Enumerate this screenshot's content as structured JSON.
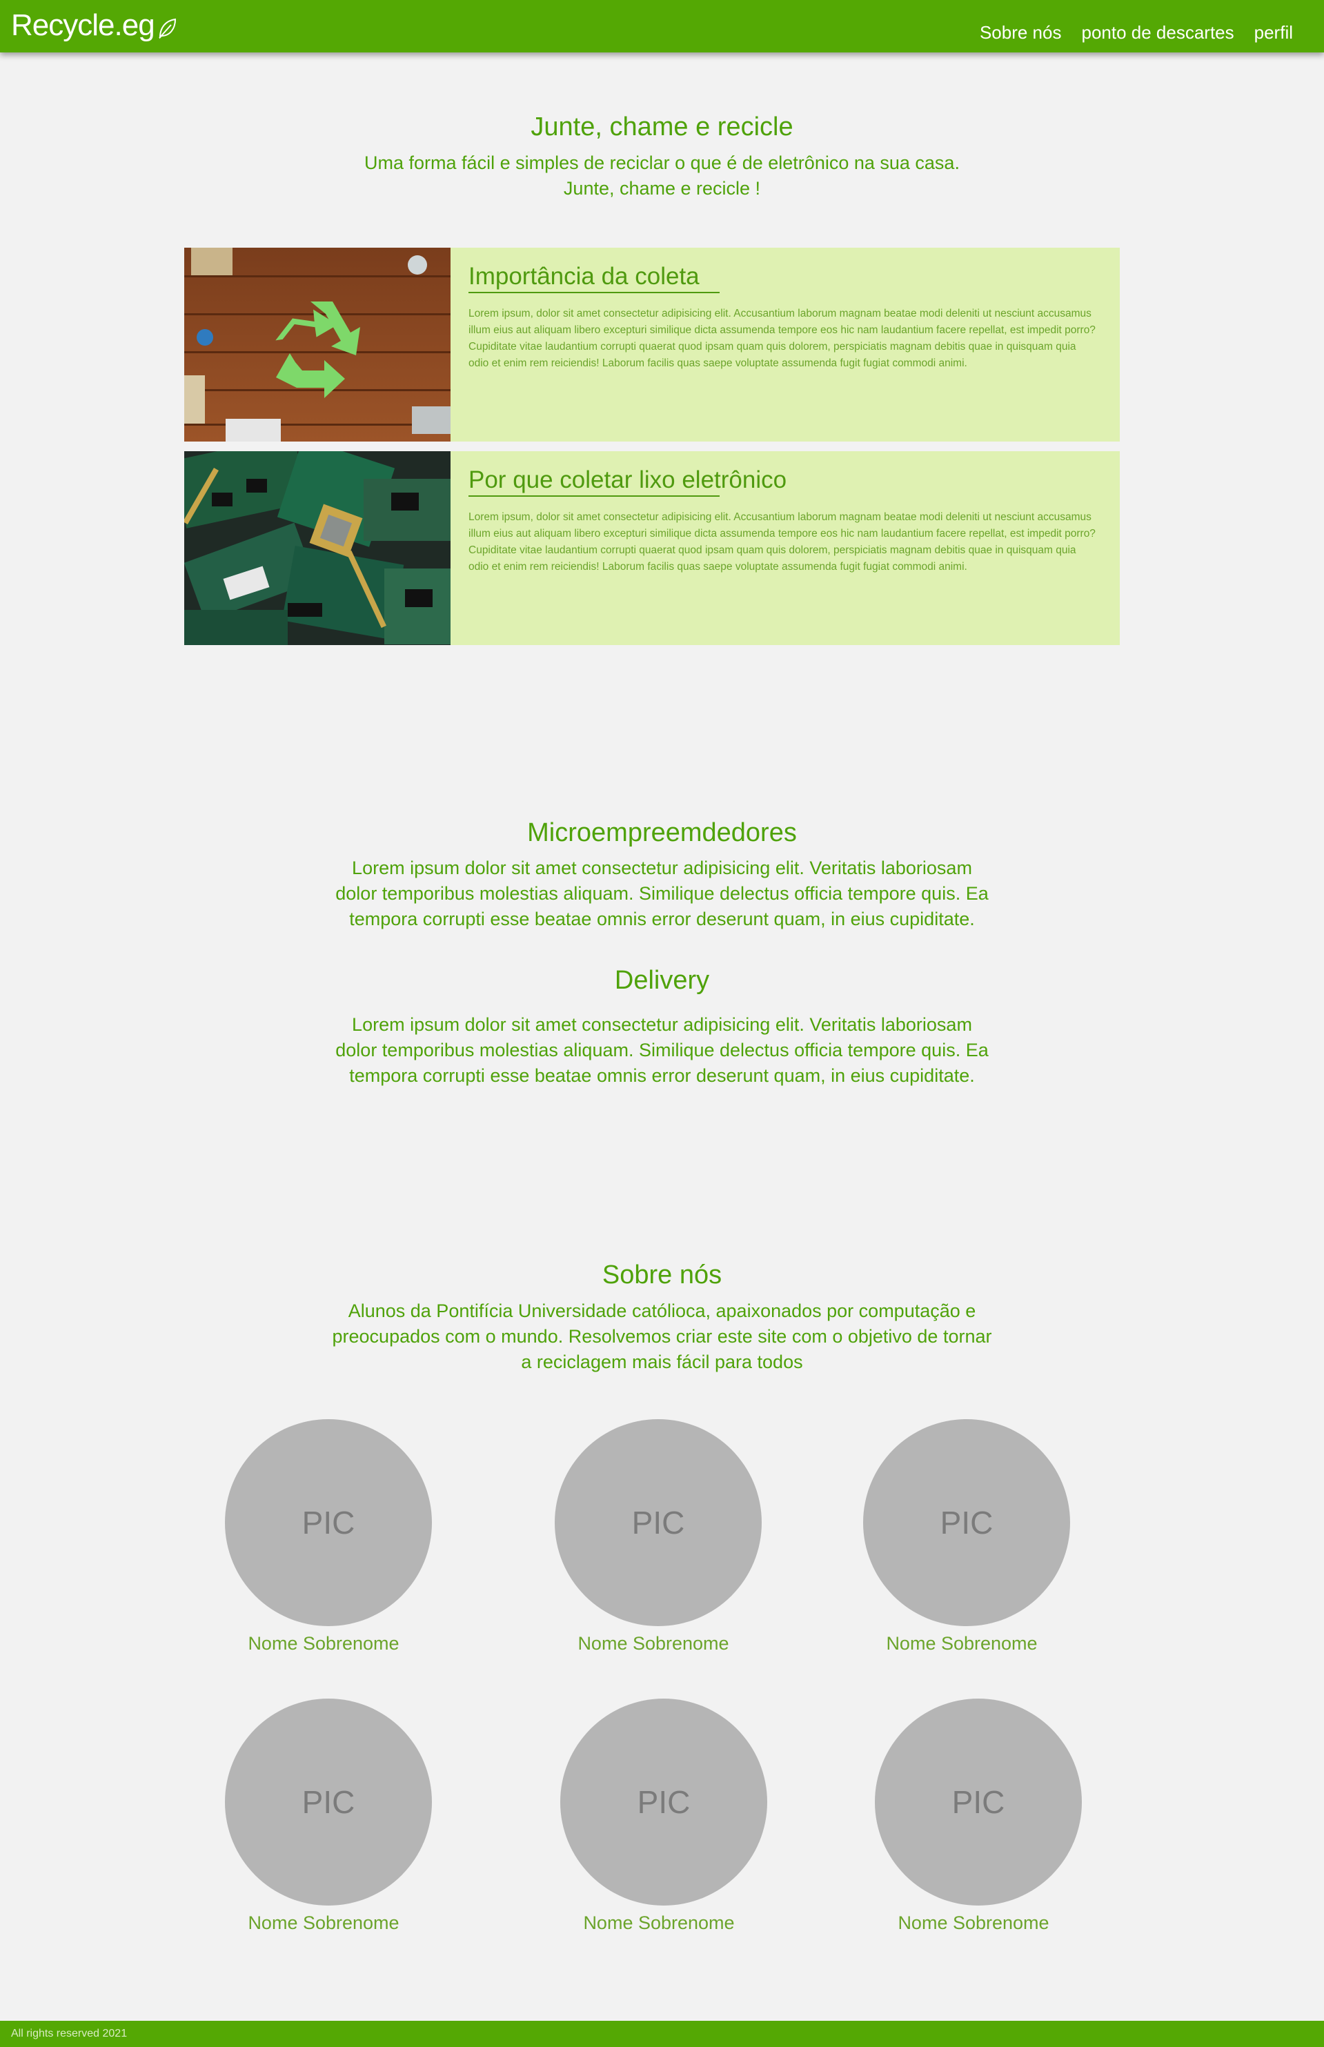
{
  "header": {
    "logo": "Recycle.eg",
    "nav": [
      "Sobre nós",
      "ponto de descartes",
      "perfil"
    ]
  },
  "hero": {
    "title": "Junte, chame e recicle",
    "subtitle_line1": "Uma forma fácil e simples de reciclar o que é de eletrônico na sua casa.",
    "subtitle_line2": "Junte, chame e recicle !"
  },
  "cards": [
    {
      "title": "Importância da coleta",
      "text": "Lorem ipsum, dolor sit amet consectetur adipisicing elit. Accusantium laborum magnam beatae modi deleniti ut nesciunt accusamus illum eius aut aliquam libero excepturi similique dicta assumenda tempore eos hic nam laudantium facere repellat, est impedit porro? Cupiditate vitae laudantium corrupti quaerat quod ipsam quam quis dolorem, perspiciatis magnam debitis quae in quisquam quia odio et enim rem reiciendis! Laborum facilis quas saepe voluptate assumenda fugit fugiat commodi animi."
    },
    {
      "title": "Por que coletar lixo eletrônico",
      "text": "Lorem ipsum, dolor sit amet consectetur adipisicing elit. Accusantium laborum magnam beatae modi deleniti ut nesciunt accusamus illum eius aut aliquam libero excepturi similique dicta assumenda tempore eos hic nam laudantium facere repellat, est impedit porro? Cupiditate vitae laudantium corrupti quaerat quod ipsam quam quis dolorem, perspiciatis magnam debitis quae in quisquam quia odio et enim rem reiciendis! Laborum facilis quas saepe voluptate assumenda fugit fugiat commodi animi."
    }
  ],
  "micro": {
    "title": "Microempreemdedores",
    "line1": "Lorem ipsum dolor sit amet consectetur adipisicing elit. Veritatis laboriosam",
    "line2": "dolor temporibus molestias aliquam. Similique delectus officia tempore quis. Ea",
    "line3": "tempora corrupti esse beatae omnis error deserunt quam, in eius cupiditate."
  },
  "delivery": {
    "title": "Delivery",
    "line1": "Lorem ipsum dolor sit amet consectetur adipisicing elit. Veritatis laboriosam",
    "line2": "dolor temporibus molestias aliquam. Similique delectus officia tempore quis. Ea",
    "line3": "tempora corrupti esse beatae omnis error deserunt quam, in eius cupiditate."
  },
  "about": {
    "title": "Sobre nós",
    "line1": "Alunos da Pontifícia Universidade católioca, apaixonados por computação e",
    "line2": "preocupados com o mundo. Resolvemos criar este site com o objetivo de tornar",
    "line3": "a reciclagem mais fácil para todos",
    "members": [
      {
        "pic": "PIC",
        "name": "Nome Sobrenome"
      },
      {
        "pic": "PIC",
        "name": "Nome Sobrenome"
      },
      {
        "pic": "PIC",
        "name": "Nome Sobrenome"
      },
      {
        "pic": "PIC",
        "name": "Nome Sobrenome"
      },
      {
        "pic": "PIC",
        "name": "Nome Sobrenome"
      },
      {
        "pic": "PIC",
        "name": "Nome Sobrenome"
      }
    ]
  },
  "footer": {
    "text": "All rights reserved 2021"
  },
  "colors": {
    "brand_green": "#54a804",
    "text_green": "#4fa20a",
    "card_bg": "#dff1b2",
    "pic_gray": "#b5b5b5"
  }
}
